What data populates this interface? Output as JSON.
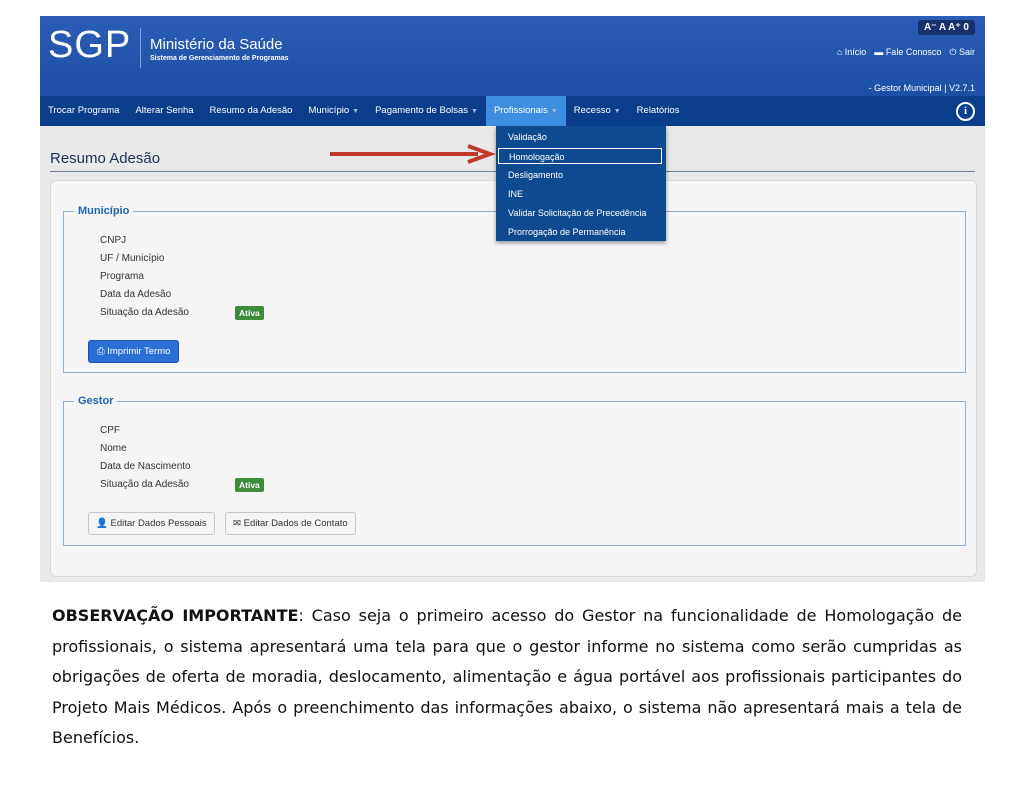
{
  "header": {
    "logo": "SGP",
    "org_name": "Ministério da Saúde",
    "org_subtitle": "Sistema de Gerenciamento de Programas",
    "font_controls": "A⁻ A A⁺ 0",
    "links": {
      "home": "Início",
      "contact": "Fale Conosco",
      "exit": "Sair"
    },
    "user_version": "- Gestor Municipal | V2.7.1"
  },
  "nav": {
    "items": [
      {
        "label": "Trocar Programa",
        "has_caret": false
      },
      {
        "label": "Alterar Senha",
        "has_caret": false
      },
      {
        "label": "Resumo da Adesão",
        "has_caret": false
      },
      {
        "label": "Município",
        "has_caret": true
      },
      {
        "label": "Pagamento de Bolsas",
        "has_caret": true
      },
      {
        "label": "Profissionais",
        "has_caret": true,
        "active": true
      },
      {
        "label": "Recesso",
        "has_caret": true
      },
      {
        "label": "Relatórios",
        "has_caret": false
      }
    ]
  },
  "dropdown": {
    "items": [
      "Validação",
      "Homologação",
      "Desligamento",
      "INE",
      "Validar Solicitação de Precedência",
      "Prorrogação de Permanência"
    ],
    "highlighted": "Homologação"
  },
  "page": {
    "title": "Resumo Adesão"
  },
  "municipio": {
    "legend": "Município",
    "fields": [
      "CNPJ",
      "UF / Município",
      "Programa",
      "Data da Adesão",
      "Situação da Adesão"
    ],
    "status": "Ativa",
    "print_button": "Imprimir Termo"
  },
  "gestor": {
    "legend": "Gestor",
    "fields": [
      "CPF",
      "Nome",
      "Data de Nascimento",
      "Situação da Adesão"
    ],
    "status": "Ativa",
    "edit_personal_button": "Editar Dados Pessoais",
    "edit_contact_button": "Editar Dados de Contato"
  },
  "note": {
    "strong": "OBSERVAÇÃO IMPORTANTE",
    "text": ": Caso seja o primeiro acesso do Gestor na funcionalidade de Homologação de profissionais, o sistema apresentará uma tela para que o gestor informe no sistema como serão cumpridas as obrigações de oferta de moradia, deslocamento, alimentação e água portável aos profissionais participantes do Projeto Mais Médicos. Após o preenchimento das informações abaixo, o sistema não apresentará mais a tela de Benefícios."
  },
  "colors": {
    "header": "#1e4fa6",
    "navbar": "#0b3e8a",
    "active_tab": "#3d8ee0",
    "dropdown": "#0e4a8f",
    "badge": "#3e8b3e",
    "arrow": "#c0392b"
  }
}
